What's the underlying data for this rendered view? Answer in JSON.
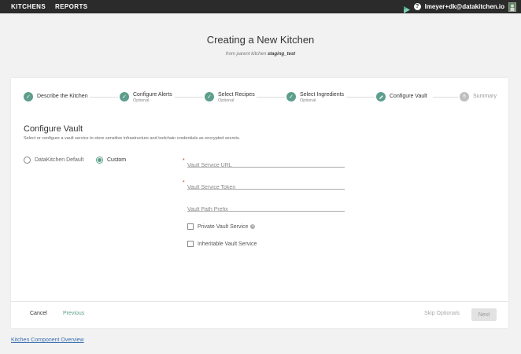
{
  "topbar": {
    "nav": [
      "KITCHENS",
      "REPORTS"
    ],
    "help": "?",
    "user": "lmeyer+dk@datakitchen.io"
  },
  "header": {
    "title": "Creating a New Kitchen",
    "subtitle_prefix": "from parent kitchen",
    "parent": "staging_test"
  },
  "steps": [
    {
      "label": "Describe the Kitchen",
      "sub": "",
      "done": true
    },
    {
      "label": "Configure Alerts",
      "sub": "Optional",
      "done": true
    },
    {
      "label": "Select Recipes",
      "sub": "Optional",
      "done": true
    },
    {
      "label": "Select Ingredients",
      "sub": "Optional",
      "done": true
    },
    {
      "label": "Configure Vault",
      "sub": "",
      "active": true
    },
    {
      "label": "Summary",
      "sub": "",
      "number": "6"
    }
  ],
  "section": {
    "title": "Configure Vault",
    "description": "Select or configure a vault service to store sensitive infrastructure and toolchain credentials as encrypted secrets."
  },
  "radios": {
    "default_label": "DataKitchen Default",
    "custom_label": "Custom",
    "selected": "custom"
  },
  "fields": {
    "url_placeholder": "Vault Service URL",
    "token_placeholder": "Vault Service Token",
    "prefix_placeholder": "Vault Path Prefix",
    "required_mark": "*"
  },
  "checkboxes": {
    "private_label": "Private Vault Service",
    "inheritable_label": "Inheritable Vault Service"
  },
  "footer": {
    "cancel": "Cancel",
    "previous": "Previous",
    "skip": "Skip Optionals",
    "next": "Next"
  },
  "bottom_link": "Kitchen Component Overview",
  "colors": {
    "accent": "#5e9e8c",
    "topbar": "#2b2b2b",
    "link": "#3a6fb0"
  }
}
